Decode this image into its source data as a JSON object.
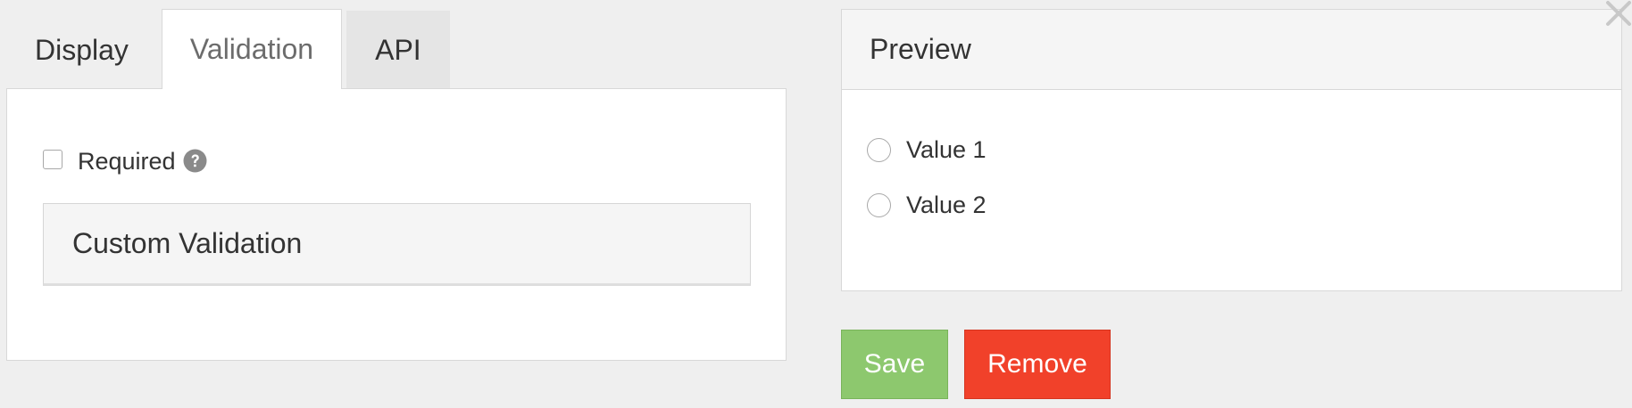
{
  "tabs": [
    {
      "label": "Display",
      "state": "inactive"
    },
    {
      "label": "Validation",
      "state": "active"
    },
    {
      "label": "API",
      "state": "inactive"
    }
  ],
  "validation": {
    "required_label": "Required",
    "required_checked": false,
    "help_icon": "question-circle-icon",
    "custom_validation_label": "Custom Validation"
  },
  "preview": {
    "title": "Preview",
    "options": [
      {
        "label": "Value 1",
        "selected": false
      },
      {
        "label": "Value 2",
        "selected": false
      }
    ]
  },
  "actions": {
    "save_label": "Save",
    "remove_label": "Remove"
  },
  "colors": {
    "save": "#8dc86e",
    "remove": "#f1412a",
    "background": "#efefef"
  },
  "close_icon": "close-icon"
}
